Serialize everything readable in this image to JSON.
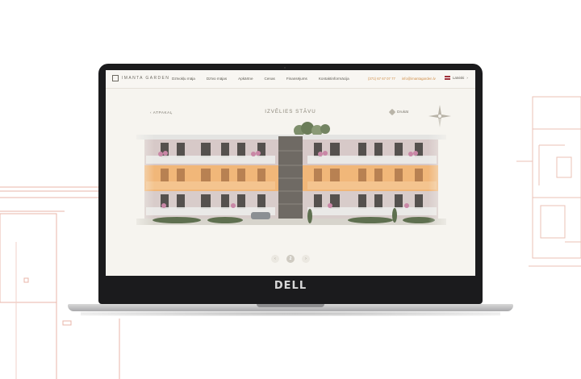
{
  "device": {
    "brand": "DELL"
  },
  "site": {
    "logo_text": "IMANTA GARDEN",
    "nav": [
      "Dzīvokļu māja",
      "Dzīvo mājas",
      "Apkārtne",
      "Cenas",
      "Finansējums",
      "Kontaktinformācija"
    ],
    "phone": "(371) 67 67 07 77",
    "email": "info@imantagarden.lv",
    "language": "Latviski"
  },
  "page": {
    "back_label": "ATPAKAĻ",
    "title": "IZVĒLIES STĀVU",
    "print_label": "Drukāt"
  },
  "pager": {
    "items": [
      "‹",
      "2",
      "›"
    ],
    "current": "2"
  },
  "colors": {
    "accent": "#d08f49",
    "highlight_floor": "#f1b779",
    "screen_bg": "#f6f4ef"
  }
}
